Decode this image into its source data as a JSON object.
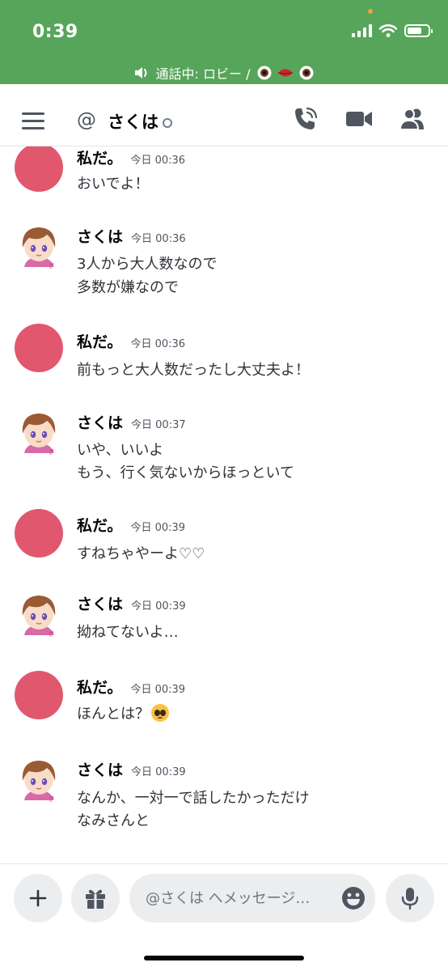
{
  "status_bar": {
    "time": "0:39",
    "call_status": "通話中: ロビー / "
  },
  "header": {
    "at": "@",
    "channel_name": "さくは"
  },
  "messages": [
    {
      "author": "私だ。",
      "timestamp": "今日 00:36",
      "lines": [
        "おいでよ！"
      ]
    },
    {
      "author": "さくは",
      "timestamp": "今日 00:36",
      "lines": [
        "3人から大人数なので",
        "多数が嫌なので"
      ]
    },
    {
      "author": "私だ。",
      "timestamp": "今日 00:36",
      "lines": [
        "前もっと大人数だったし大丈夫よ！"
      ]
    },
    {
      "author": "さくは",
      "timestamp": "今日 00:37",
      "lines": [
        "いや、いいよ",
        "もう、行く気ないからほっといて"
      ]
    },
    {
      "author": "私だ。",
      "timestamp": "今日 00:39",
      "lines": [
        "すねちゃやーよ♡♡"
      ]
    },
    {
      "author": "さくは",
      "timestamp": "今日 00:39",
      "lines": [
        "拗ねてないよ…"
      ]
    },
    {
      "author": "私だ。",
      "timestamp": "今日 00:39",
      "lines": [
        "ほんとは？"
      ]
    },
    {
      "author": "さくは",
      "timestamp": "今日 00:39",
      "lines": [
        "なんか、一対一で話したかっただけ",
        "なみさんと"
      ]
    }
  ],
  "composer": {
    "placeholder": "@さくは へメッセージ…"
  },
  "colors": {
    "call_bar": "#57a55a",
    "avatar_pink": "#e1576e",
    "icon_gray": "#4f5660"
  },
  "icons": [
    "hamburger-icon",
    "speaker-icon",
    "phone-call-icon",
    "video-camera-icon",
    "members-icon",
    "plus-icon",
    "gift-icon",
    "emoji-icon",
    "microphone-icon",
    "pleading-face-emoji"
  ]
}
